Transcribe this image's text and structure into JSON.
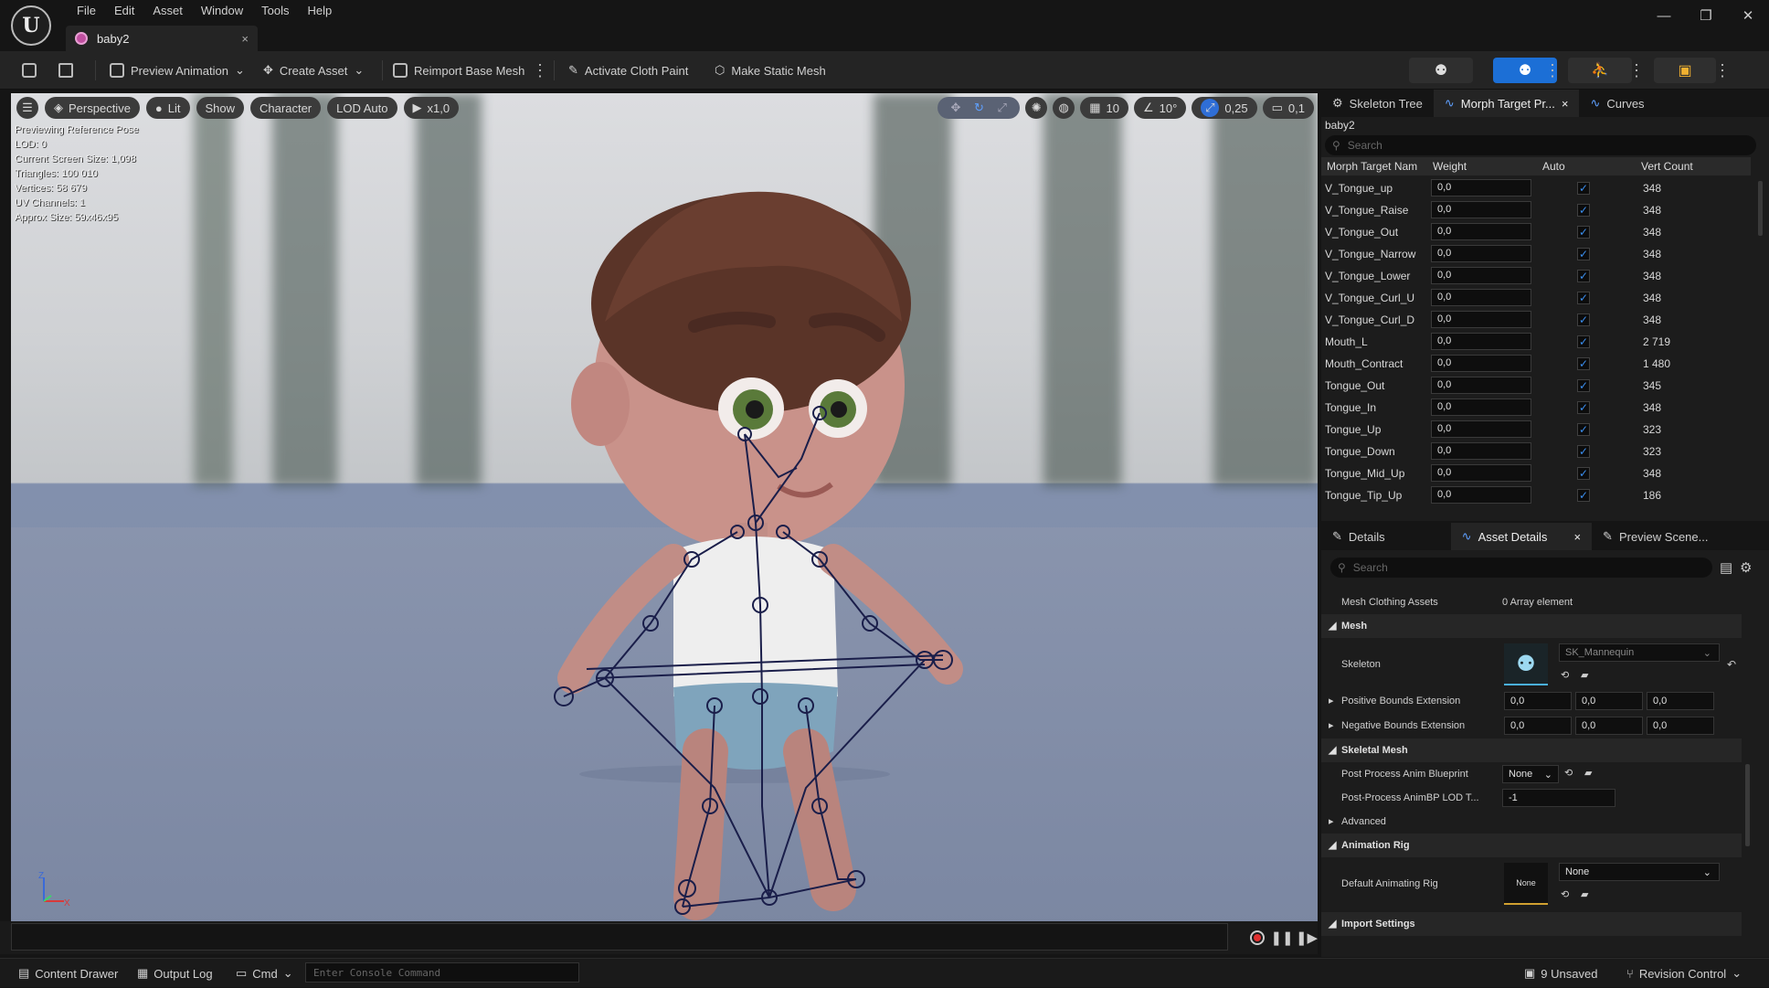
{
  "menu": [
    "File",
    "Edit",
    "Asset",
    "Window",
    "Tools",
    "Help"
  ],
  "doc_tab": {
    "title": "baby2"
  },
  "toolbar": {
    "preview_animation": "Preview Animation",
    "create_asset": "Create Asset",
    "reimport": "Reimport Base Mesh",
    "cloth_paint": "Activate Cloth Paint",
    "static_mesh": "Make Static Mesh"
  },
  "viewport": {
    "perspective": "Perspective",
    "lit": "Lit",
    "show": "Show",
    "character": "Character",
    "lod": "LOD Auto",
    "play_rate": "x1,0",
    "grid": "10",
    "angle": "10°",
    "scale": "0,25",
    "camera": "0,1",
    "stats": [
      "Previewing Reference Pose",
      "LOD: 0",
      "Current Screen Size: 1,098",
      "Triangles: 100 010",
      "Vertices: 58 679",
      "UV Channels: 1",
      "Approx Size: 59x46x95"
    ],
    "axis_z": "Z",
    "axis_x": "X"
  },
  "skeleton_panel": {
    "tabs": [
      "Skeleton Tree",
      "Morph Target Pr...",
      "Curves"
    ],
    "asset_name": "baby2",
    "search_placeholder": "Search",
    "columns": [
      "Morph Target Nam",
      "Weight",
      "Auto",
      "Vert Count"
    ],
    "rows": [
      {
        "name": "V_Tongue_up",
        "weight": "0,0",
        "count": "348"
      },
      {
        "name": "V_Tongue_Raise",
        "weight": "0,0",
        "count": "348"
      },
      {
        "name": "V_Tongue_Out",
        "weight": "0,0",
        "count": "348"
      },
      {
        "name": "V_Tongue_Narrow",
        "weight": "0,0",
        "count": "348"
      },
      {
        "name": "V_Tongue_Lower",
        "weight": "0,0",
        "count": "348"
      },
      {
        "name": "V_Tongue_Curl_U",
        "weight": "0,0",
        "count": "348"
      },
      {
        "name": "V_Tongue_Curl_D",
        "weight": "0,0",
        "count": "348"
      },
      {
        "name": "Mouth_L",
        "weight": "0,0",
        "count": "2 719"
      },
      {
        "name": "Mouth_Contract",
        "weight": "0,0",
        "count": "1 480"
      },
      {
        "name": "Tongue_Out",
        "weight": "0,0",
        "count": "345"
      },
      {
        "name": "Tongue_In",
        "weight": "0,0",
        "count": "348"
      },
      {
        "name": "Tongue_Up",
        "weight": "0,0",
        "count": "323"
      },
      {
        "name": "Tongue_Down",
        "weight": "0,0",
        "count": "323"
      },
      {
        "name": "Tongue_Mid_Up",
        "weight": "0,0",
        "count": "348"
      },
      {
        "name": "Tongue_Tip_Up",
        "weight": "0,0",
        "count": "186"
      }
    ]
  },
  "details_panel": {
    "tabs": [
      "Details",
      "Asset Details",
      "Preview Scene..."
    ],
    "search_placeholder": "Search",
    "mesh_clothing_label": "Mesh Clothing Assets",
    "mesh_clothing_value": "0 Array element",
    "cat_mesh": "Mesh",
    "skeleton_label": "Skeleton",
    "skeleton_value": "SK_Mannequin",
    "pos_bounds_label": "Positive Bounds Extension",
    "pos_bounds": [
      "0,0",
      "0,0",
      "0,0"
    ],
    "neg_bounds_label": "Negative Bounds Extension",
    "neg_bounds": [
      "0,0",
      "0,0",
      "0,0"
    ],
    "cat_skeletal": "Skeletal Mesh",
    "pp_anim_label": "Post Process Anim Blueprint",
    "pp_anim_value": "None",
    "pp_lod_label": "Post-Process AnimBP LOD T...",
    "pp_lod_value": "-1",
    "advanced": "Advanced",
    "cat_anim_rig": "Animation Rig",
    "default_rig_label": "Default Animating Rig",
    "default_rig_thumb": "None",
    "default_rig_value": "None",
    "cat_import": "Import Settings"
  },
  "statusbar": {
    "content_drawer": "Content Drawer",
    "output_log": "Output Log",
    "cmd": "Cmd",
    "console_placeholder": "Enter Console Command",
    "unsaved": "9 Unsaved",
    "revision": "Revision Control"
  }
}
